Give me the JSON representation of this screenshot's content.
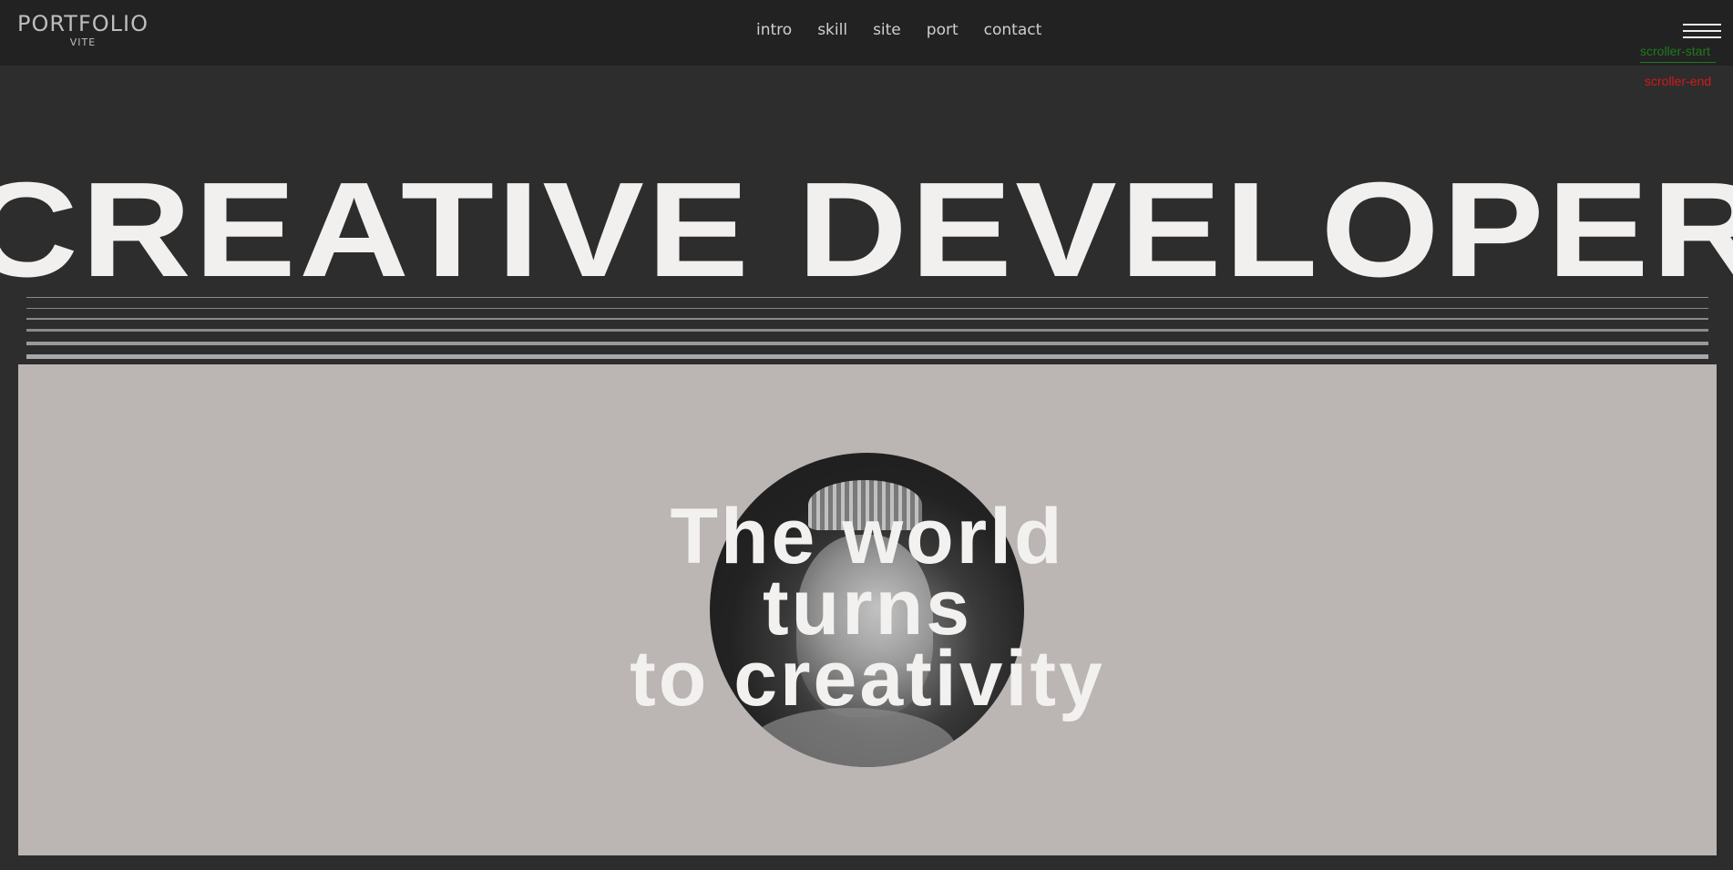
{
  "header": {
    "logo_title": "PORTFOLIO",
    "logo_subtitle": "VITE",
    "nav": [
      "intro",
      "skill",
      "site",
      "port",
      "contact"
    ],
    "menu_icon": "hamburger-icon"
  },
  "markers": {
    "start": "scroller-start",
    "end": "scroller-end"
  },
  "hero": {
    "headline": "CREATIVE DEVELOPER"
  },
  "panel": {
    "tagline": [
      "The world",
      "turns",
      "to creativity"
    ],
    "image": "queen-portrait"
  },
  "colors": {
    "background": "#2d2d2d",
    "header": "#222222",
    "panel": "#bbb5b4",
    "text_light": "#f1f0ee",
    "marker_start": "#1f7a1f",
    "marker_end": "#d11a1a"
  }
}
